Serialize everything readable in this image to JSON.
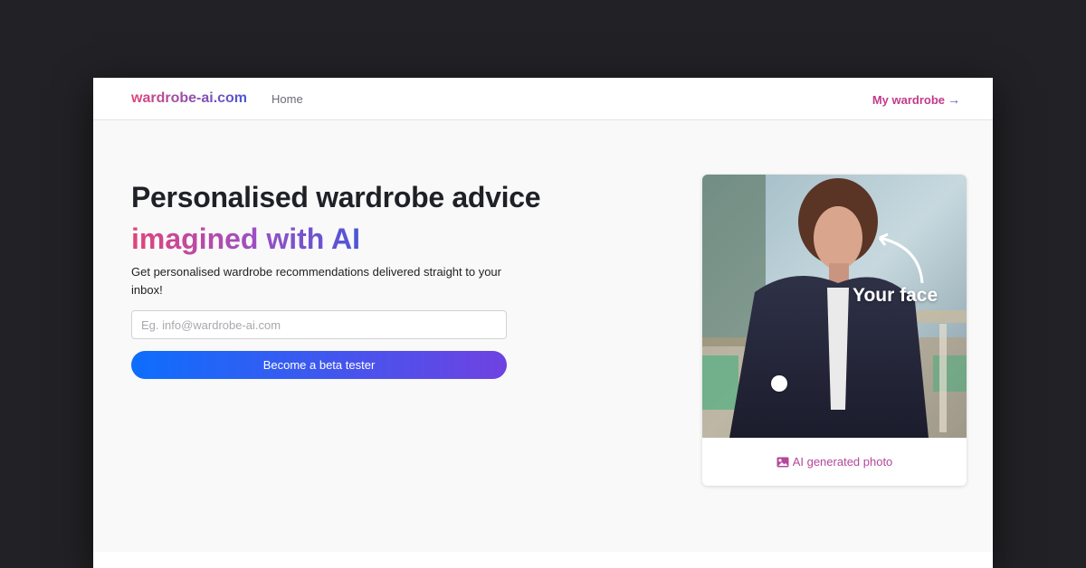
{
  "navbar": {
    "brand": "wardrobe-ai.com",
    "home_link": "Home",
    "wardrobe_link": "My wardrobe",
    "wardrobe_arrow": "→"
  },
  "hero": {
    "title": "Personalised wardrobe advice",
    "accent": "imagined with AI",
    "subtitle": "Get personalised wardrobe recommendations delivered straight to your inbox!",
    "email_placeholder": "Eg. info@wardrobe-ai.com",
    "email_value": "",
    "cta_label": "Become a beta tester"
  },
  "photo_card": {
    "overlay_text": "Your face",
    "caption": "AI generated photo",
    "caption_icon": "image-icon"
  },
  "colors": {
    "page_bg": "#222226",
    "brand_gradient_start": "#e0457b",
    "brand_gradient_end": "#4b56d8",
    "button_gradient_start": "#0d6efd",
    "button_gradient_end": "#6f42e1",
    "caption_color": "#b3479a"
  }
}
